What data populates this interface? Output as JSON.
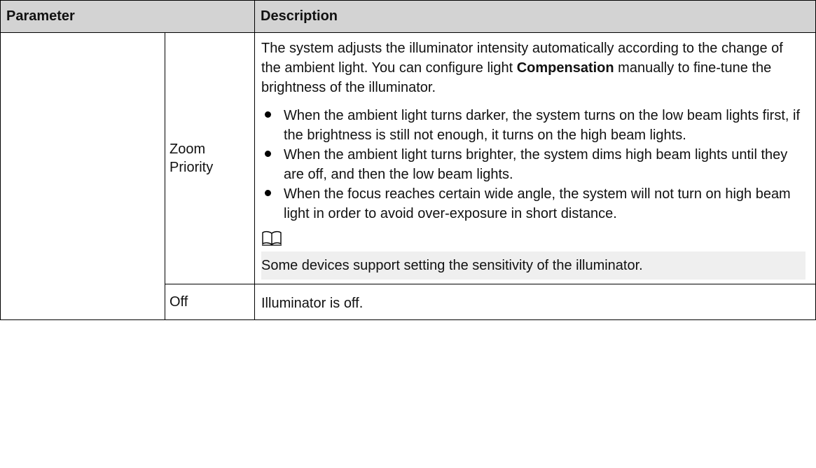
{
  "table": {
    "headers": {
      "parameter": "Parameter",
      "description": "Description"
    },
    "rows": [
      {
        "sub_param": {
          "line1": "Zoom",
          "line2": "Priority"
        },
        "intro": {
          "text_before": "The system adjusts the illuminator intensity automatically according to the change of the ambient light. You can configure light ",
          "bold": "Compensation",
          "text_after": "  manually to fine-tune the brightness of the illuminator."
        },
        "bullets": [
          "When the ambient light turns darker, the system turns on the low beam lights first, if the brightness is still not enough, it turns on the high beam lights.",
          "When the ambient light turns brighter, the system dims high beam lights until they are off, and then the low beam lights.",
          "When the focus reaches certain wide angle, the system will not turn on high beam light in order to avoid over-exposure in short distance."
        ],
        "note_icon": "book-icon",
        "note": "Some devices support setting the sensitivity of the illuminator."
      },
      {
        "sub_param": "Off",
        "description": "Illuminator is off."
      }
    ]
  }
}
